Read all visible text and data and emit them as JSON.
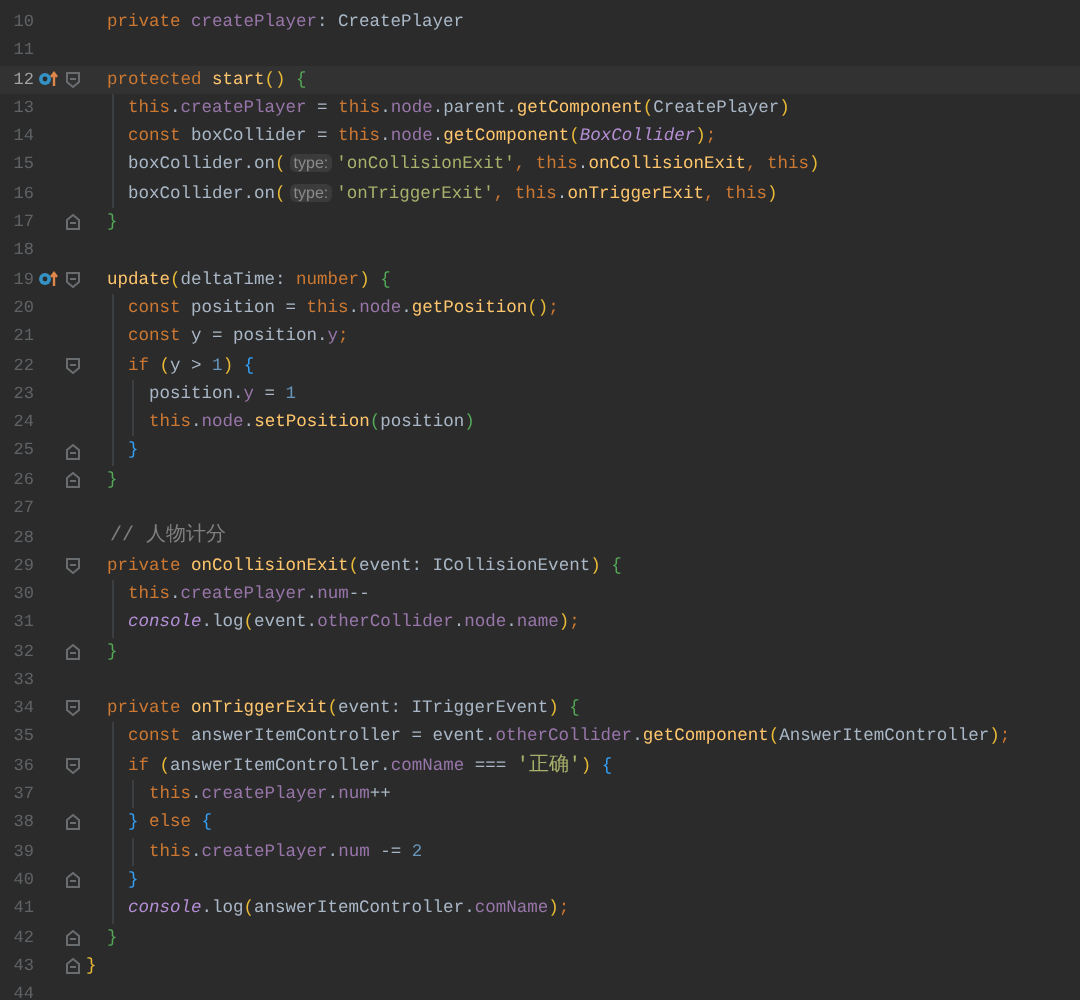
{
  "editor": {
    "lines": [
      {
        "number": "10",
        "current": false,
        "override_marker": false,
        "fold_start": false,
        "fold_end": false,
        "tokens": [
          {
            "t": "  private ",
            "kind": "kw"
          },
          {
            "t": "createPlayer",
            "kind": "field"
          },
          {
            "t": ": CreatePlayer",
            "kind": "plain"
          }
        ]
      },
      {
        "number": "11",
        "current": false,
        "override_marker": false,
        "fold_start": false,
        "fold_end": false
      },
      {
        "number": "12",
        "current": true,
        "override_marker": true,
        "fold_start": true,
        "fold_end": false,
        "tokens": [
          {
            "t": "  protected ",
            "kind": "kw"
          },
          {
            "t": "start",
            "kind": "fn"
          },
          {
            "t": "() ",
            "kind": "b1"
          },
          {
            "t": "{",
            "kind": "b2"
          }
        ]
      },
      {
        "number": "13",
        "current": false,
        "override_marker": false,
        "fold_start": false,
        "fold_end": false,
        "tokens": [
          {
            "t": "    this",
            "kind": "kw"
          },
          {
            "t": ".",
            "kind": "plain"
          },
          {
            "t": "createPlayer",
            "kind": "field"
          },
          {
            "t": " = ",
            "kind": "plain"
          },
          {
            "t": "this",
            "kind": "kw"
          },
          {
            "t": ".",
            "kind": "plain"
          },
          {
            "t": "node",
            "kind": "field"
          },
          {
            "t": ".parent.",
            "kind": "plain"
          },
          {
            "t": "getComponent",
            "kind": "fn"
          },
          {
            "t": "(",
            "kind": "b1"
          },
          {
            "t": "CreatePlayer",
            "kind": "plain"
          },
          {
            "t": ")",
            "kind": "b1"
          }
        ]
      },
      {
        "number": "14",
        "current": false,
        "override_marker": false,
        "fold_start": false,
        "fold_end": false,
        "tokens": [
          {
            "t": "    const",
            "kind": "kw"
          },
          {
            "t": " boxCollider = ",
            "kind": "plain"
          },
          {
            "t": "this",
            "kind": "kw"
          },
          {
            "t": ".",
            "kind": "plain"
          },
          {
            "t": "node",
            "kind": "field"
          },
          {
            "t": ".",
            "kind": "plain"
          },
          {
            "t": "getComponent",
            "kind": "fn"
          },
          {
            "t": "(",
            "kind": "b1"
          },
          {
            "t": "BoxCollider",
            "kind": "italic"
          },
          {
            "t": ")",
            "kind": "b1"
          },
          {
            "t": ";",
            "kind": "kw"
          }
        ]
      },
      {
        "number": "15",
        "current": false,
        "override_marker": false,
        "fold_start": false,
        "fold_end": false,
        "tokens": [
          {
            "t": "    boxCollider.on",
            "kind": "plain"
          },
          {
            "t": "(",
            "kind": "b1"
          },
          {
            "t": "type:",
            "kind": "hint"
          },
          {
            "t": "'onCollisionExit'",
            "kind": "str"
          },
          {
            "t": ", ",
            "kind": "kw"
          },
          {
            "t": "this",
            "kind": "kw"
          },
          {
            "t": ".",
            "kind": "plain"
          },
          {
            "t": "onCollisionExit",
            "kind": "fn"
          },
          {
            "t": ", this",
            "kind": "kw"
          },
          {
            "t": ")",
            "kind": "b1"
          }
        ]
      },
      {
        "number": "16",
        "current": false,
        "override_marker": false,
        "fold_start": false,
        "fold_end": false,
        "tokens": [
          {
            "t": "    boxCollider.on",
            "kind": "plain"
          },
          {
            "t": "(",
            "kind": "b1"
          },
          {
            "t": "type:",
            "kind": "hint"
          },
          {
            "t": "'onTriggerExit'",
            "kind": "str"
          },
          {
            "t": ", ",
            "kind": "kw"
          },
          {
            "t": "this",
            "kind": "kw"
          },
          {
            "t": ".",
            "kind": "plain"
          },
          {
            "t": "onTriggerExit",
            "kind": "fn"
          },
          {
            "t": ", this",
            "kind": "kw"
          },
          {
            "t": ")",
            "kind": "b1"
          }
        ]
      },
      {
        "number": "17",
        "current": false,
        "override_marker": false,
        "fold_start": false,
        "fold_end": true,
        "tokens": [
          {
            "t": "  }",
            "kind": "b2"
          }
        ]
      },
      {
        "number": "18",
        "current": false,
        "override_marker": false,
        "fold_start": false,
        "fold_end": false
      },
      {
        "number": "19",
        "current": false,
        "override_marker": true,
        "fold_start": true,
        "fold_end": false,
        "tokens": [
          {
            "t": "  update",
            "kind": "fn"
          },
          {
            "t": "(",
            "kind": "b1"
          },
          {
            "t": "deltaTime: ",
            "kind": "plain"
          },
          {
            "t": "number",
            "kind": "kw"
          },
          {
            "t": ") ",
            "kind": "b1"
          },
          {
            "t": "{",
            "kind": "b2"
          }
        ]
      },
      {
        "number": "20",
        "current": false,
        "override_marker": false,
        "fold_start": false,
        "fold_end": false,
        "tokens": [
          {
            "t": "    const",
            "kind": "kw"
          },
          {
            "t": " position = ",
            "kind": "plain"
          },
          {
            "t": "this",
            "kind": "kw"
          },
          {
            "t": ".",
            "kind": "plain"
          },
          {
            "t": "node",
            "kind": "field"
          },
          {
            "t": ".",
            "kind": "plain"
          },
          {
            "t": "getPosition",
            "kind": "fn"
          },
          {
            "t": "()",
            "kind": "b1"
          },
          {
            "t": ";",
            "kind": "kw"
          }
        ]
      },
      {
        "number": "21",
        "current": false,
        "override_marker": false,
        "fold_start": false,
        "fold_end": false,
        "tokens": [
          {
            "t": "    const",
            "kind": "kw"
          },
          {
            "t": " y = position.",
            "kind": "plain"
          },
          {
            "t": "y",
            "kind": "field"
          },
          {
            "t": ";",
            "kind": "kw"
          }
        ]
      },
      {
        "number": "22",
        "current": false,
        "override_marker": false,
        "fold_start": true,
        "fold_end": false,
        "tokens": [
          {
            "t": "    if ",
            "kind": "kw"
          },
          {
            "t": "(",
            "kind": "b1"
          },
          {
            "t": "y > ",
            "kind": "plain"
          },
          {
            "t": "1",
            "kind": "num"
          },
          {
            "t": ") ",
            "kind": "b1"
          },
          {
            "t": "{",
            "kind": "b3"
          }
        ]
      },
      {
        "number": "23",
        "current": false,
        "override_marker": false,
        "fold_start": false,
        "fold_end": false,
        "tokens": [
          {
            "t": "      position.",
            "kind": "plain"
          },
          {
            "t": "y",
            "kind": "field"
          },
          {
            "t": " = ",
            "kind": "plain"
          },
          {
            "t": "1",
            "kind": "num"
          }
        ]
      },
      {
        "number": "24",
        "current": false,
        "override_marker": false,
        "fold_start": false,
        "fold_end": false,
        "tokens": [
          {
            "t": "      this",
            "kind": "kw"
          },
          {
            "t": ".",
            "kind": "plain"
          },
          {
            "t": "node",
            "kind": "field"
          },
          {
            "t": ".",
            "kind": "plain"
          },
          {
            "t": "setPosition",
            "kind": "fn"
          },
          {
            "t": "(",
            "kind": "b2"
          },
          {
            "t": "position",
            "kind": "plain"
          },
          {
            "t": ")",
            "kind": "b2"
          }
        ]
      },
      {
        "number": "25",
        "current": false,
        "override_marker": false,
        "fold_start": false,
        "fold_end": true,
        "tokens": [
          {
            "t": "    }",
            "kind": "b3"
          }
        ]
      },
      {
        "number": "26",
        "current": false,
        "override_marker": false,
        "fold_start": false,
        "fold_end": true,
        "tokens": [
          {
            "t": "  }",
            "kind": "b2"
          }
        ]
      },
      {
        "number": "27",
        "current": false,
        "override_marker": false,
        "fold_start": false,
        "fold_end": false
      },
      {
        "number": "28",
        "current": false,
        "override_marker": false,
        "fold_start": false,
        "fold_end": false,
        "tokens": [
          {
            "t": "  // 人物计分",
            "kind": "comment"
          }
        ]
      },
      {
        "number": "29",
        "current": false,
        "override_marker": false,
        "fold_start": true,
        "fold_end": false,
        "tokens": [
          {
            "t": "  private ",
            "kind": "kw"
          },
          {
            "t": "onCollisionExit",
            "kind": "fn"
          },
          {
            "t": "(",
            "kind": "b1"
          },
          {
            "t": "event: ICollisionEvent",
            "kind": "plain"
          },
          {
            "t": ") ",
            "kind": "b1"
          },
          {
            "t": "{",
            "kind": "b2"
          }
        ]
      },
      {
        "number": "30",
        "current": false,
        "override_marker": false,
        "fold_start": false,
        "fold_end": false,
        "tokens": [
          {
            "t": "    this",
            "kind": "kw"
          },
          {
            "t": ".",
            "kind": "plain"
          },
          {
            "t": "createPlayer",
            "kind": "field"
          },
          {
            "t": ".",
            "kind": "plain"
          },
          {
            "t": "num",
            "kind": "field"
          },
          {
            "t": "--",
            "kind": "plain"
          }
        ]
      },
      {
        "number": "31",
        "current": false,
        "override_marker": false,
        "fold_start": false,
        "fold_end": false,
        "tokens": [
          {
            "t": "    console",
            "kind": "italic"
          },
          {
            "t": ".log",
            "kind": "plain"
          },
          {
            "t": "(",
            "kind": "b1"
          },
          {
            "t": "event.",
            "kind": "plain"
          },
          {
            "t": "otherCollider",
            "kind": "field"
          },
          {
            "t": ".",
            "kind": "plain"
          },
          {
            "t": "node",
            "kind": "field"
          },
          {
            "t": ".",
            "kind": "plain"
          },
          {
            "t": "name",
            "kind": "field"
          },
          {
            "t": ")",
            "kind": "b1"
          },
          {
            "t": ";",
            "kind": "kw"
          }
        ]
      },
      {
        "number": "32",
        "current": false,
        "override_marker": false,
        "fold_start": false,
        "fold_end": true,
        "tokens": [
          {
            "t": "  }",
            "kind": "b2"
          }
        ]
      },
      {
        "number": "33",
        "current": false,
        "override_marker": false,
        "fold_start": false,
        "fold_end": false
      },
      {
        "number": "34",
        "current": false,
        "override_marker": false,
        "fold_start": true,
        "fold_end": false,
        "tokens": [
          {
            "t": "  private ",
            "kind": "kw"
          },
          {
            "t": "onTriggerExit",
            "kind": "fn"
          },
          {
            "t": "(",
            "kind": "b1"
          },
          {
            "t": "event: ITriggerEvent",
            "kind": "plain"
          },
          {
            "t": ") ",
            "kind": "b1"
          },
          {
            "t": "{",
            "kind": "b2"
          }
        ]
      },
      {
        "number": "35",
        "current": false,
        "override_marker": false,
        "fold_start": false,
        "fold_end": false,
        "tokens": [
          {
            "t": "    const",
            "kind": "kw"
          },
          {
            "t": " answerItemController = event.",
            "kind": "plain"
          },
          {
            "t": "otherCollider",
            "kind": "field"
          },
          {
            "t": ".",
            "kind": "plain"
          },
          {
            "t": "getComponent",
            "kind": "fn"
          },
          {
            "t": "(",
            "kind": "b1"
          },
          {
            "t": "AnswerItemController",
            "kind": "plain"
          },
          {
            "t": ")",
            "kind": "b1"
          },
          {
            "t": ";",
            "kind": "kw"
          }
        ]
      },
      {
        "number": "36",
        "current": false,
        "override_marker": false,
        "fold_start": true,
        "fold_end": false,
        "tokens": [
          {
            "t": "    if ",
            "kind": "kw"
          },
          {
            "t": "(",
            "kind": "b1"
          },
          {
            "t": "answerItemController.",
            "kind": "plain"
          },
          {
            "t": "comName",
            "kind": "field"
          },
          {
            "t": " === ",
            "kind": "plain"
          },
          {
            "t": "'正确'",
            "kind": "str"
          },
          {
            "t": ") ",
            "kind": "b1"
          },
          {
            "t": "{",
            "kind": "b3"
          }
        ]
      },
      {
        "number": "37",
        "current": false,
        "override_marker": false,
        "fold_start": false,
        "fold_end": false,
        "tokens": [
          {
            "t": "      this",
            "kind": "kw"
          },
          {
            "t": ".",
            "kind": "plain"
          },
          {
            "t": "createPlayer",
            "kind": "field"
          },
          {
            "t": ".",
            "kind": "plain"
          },
          {
            "t": "num",
            "kind": "field"
          },
          {
            "t": "++",
            "kind": "plain"
          }
        ]
      },
      {
        "number": "38",
        "current": false,
        "override_marker": false,
        "fold_start": false,
        "fold_end": true,
        "tokens": [
          {
            "t": "    } ",
            "kind": "b3"
          },
          {
            "t": "else ",
            "kind": "kw"
          },
          {
            "t": "{",
            "kind": "b3"
          }
        ]
      },
      {
        "number": "39",
        "current": false,
        "override_marker": false,
        "fold_start": false,
        "fold_end": false,
        "tokens": [
          {
            "t": "      this",
            "kind": "kw"
          },
          {
            "t": ".",
            "kind": "plain"
          },
          {
            "t": "createPlayer",
            "kind": "field"
          },
          {
            "t": ".",
            "kind": "plain"
          },
          {
            "t": "num",
            "kind": "field"
          },
          {
            "t": " -= ",
            "kind": "plain"
          },
          {
            "t": "2",
            "kind": "num"
          }
        ]
      },
      {
        "number": "40",
        "current": false,
        "override_marker": false,
        "fold_start": false,
        "fold_end": true,
        "tokens": [
          {
            "t": "    }",
            "kind": "b3"
          }
        ]
      },
      {
        "number": "41",
        "current": false,
        "override_marker": false,
        "fold_start": false,
        "fold_end": false,
        "tokens": [
          {
            "t": "    console",
            "kind": "italic"
          },
          {
            "t": ".log",
            "kind": "plain"
          },
          {
            "t": "(",
            "kind": "b1"
          },
          {
            "t": "answerItemController.",
            "kind": "plain"
          },
          {
            "t": "comName",
            "kind": "field"
          },
          {
            "t": ")",
            "kind": "b1"
          },
          {
            "t": ";",
            "kind": "kw"
          }
        ]
      },
      {
        "number": "42",
        "current": false,
        "override_marker": false,
        "fold_start": false,
        "fold_end": true,
        "tokens": [
          {
            "t": "  }",
            "kind": "b2"
          }
        ]
      },
      {
        "number": "43",
        "current": false,
        "override_marker": false,
        "fold_start": false,
        "fold_end": true,
        "tokens": [
          {
            "t": "}",
            "kind": "b1"
          }
        ]
      },
      {
        "number": "44",
        "current": false,
        "override_marker": false,
        "fold_start": false,
        "fold_end": false
      }
    ]
  }
}
